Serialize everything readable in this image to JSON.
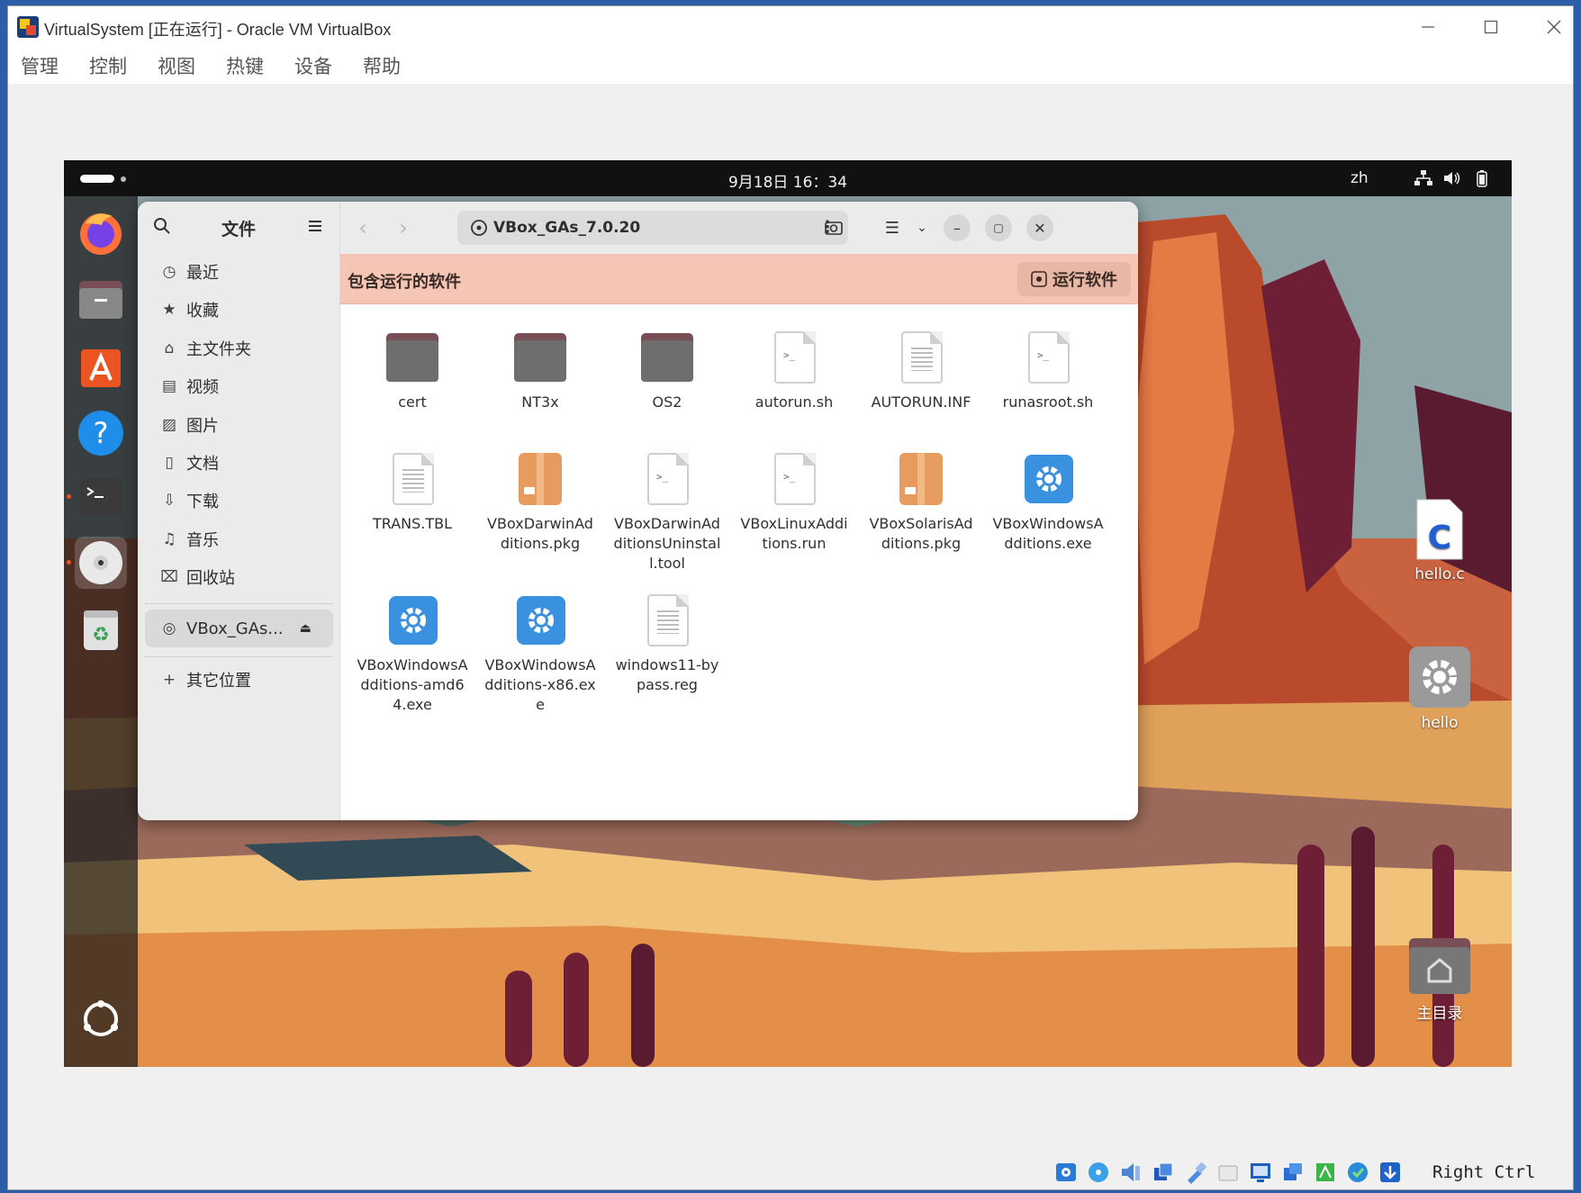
{
  "window": {
    "title": "VirtualSystem [正在运行] - Oracle VM VirtualBox",
    "controls": [
      "minimize",
      "maximize",
      "close"
    ]
  },
  "menubar": {
    "items": [
      "管理",
      "控制",
      "视图",
      "热键",
      "设备",
      "帮助"
    ]
  },
  "guest": {
    "topbar": {
      "clock": "9月18日 16：34",
      "lang": "zh"
    },
    "dock": {
      "items": [
        "firefox-icon",
        "files-icon",
        "app-center-icon",
        "help-icon",
        "terminal-icon",
        "disc-icon",
        "trash-icon",
        "show-apps-icon"
      ]
    },
    "files": {
      "sidebar": {
        "title": "文件",
        "items": [
          {
            "icon": "clock-icon",
            "label": "最近"
          },
          {
            "icon": "star-icon",
            "label": "收藏"
          },
          {
            "icon": "home-icon",
            "label": "主文件夹"
          },
          {
            "icon": "video-icon",
            "label": "视频"
          },
          {
            "icon": "image-icon",
            "label": "图片"
          },
          {
            "icon": "document-icon",
            "label": "文档"
          },
          {
            "icon": "download-icon",
            "label": "下载"
          },
          {
            "icon": "music-icon",
            "label": "音乐"
          },
          {
            "icon": "trash-icon",
            "label": "回收站"
          }
        ],
        "mount": "VBox_GAs...",
        "other": "其它位置"
      },
      "path": "VBox_GAs_7.0.20",
      "banner": {
        "text": "包含运行的软件",
        "button": "运行软件"
      },
      "items": [
        {
          "name": "cert",
          "type": "folder"
        },
        {
          "name": "NT3x",
          "type": "folder"
        },
        {
          "name": "OS2",
          "type": "folder"
        },
        {
          "name": "autorun.sh",
          "type": "script"
        },
        {
          "name": "AUTORUN.INF",
          "type": "text"
        },
        {
          "name": "runasroot.sh",
          "type": "script"
        },
        {
          "name": "TRANS.TBL",
          "type": "text"
        },
        {
          "name": "VBoxDarwinAdditions.pkg",
          "type": "package"
        },
        {
          "name": "VBoxDarwinAdditionsUninstall.tool",
          "type": "script"
        },
        {
          "name": "VBoxLinuxAdditions.run",
          "type": "script"
        },
        {
          "name": "VBoxSolarisAdditions.pkg",
          "type": "package"
        },
        {
          "name": "VBoxWindowsAdditions.exe",
          "type": "exe"
        },
        {
          "name": "VBoxWindowsAdditions-amd64.exe",
          "type": "exe"
        },
        {
          "name": "VBoxWindowsAdditions-x86.exe",
          "type": "exe"
        },
        {
          "name": "windows11-bypass.reg",
          "type": "text"
        }
      ]
    },
    "desktop": {
      "hello_c": "hello.c",
      "hello": "hello",
      "home": "主目录"
    }
  },
  "statusbar": {
    "host_key": "Right Ctrl",
    "icons": [
      "hard-disk-icon",
      "optical-disk-icon",
      "audio-icon",
      "network-icon",
      "usb-icon",
      "shared-folder-icon",
      "display-icon",
      "recording-icon",
      "cpu-icon",
      "mouse-integration-icon",
      "keyboard-icon"
    ]
  }
}
